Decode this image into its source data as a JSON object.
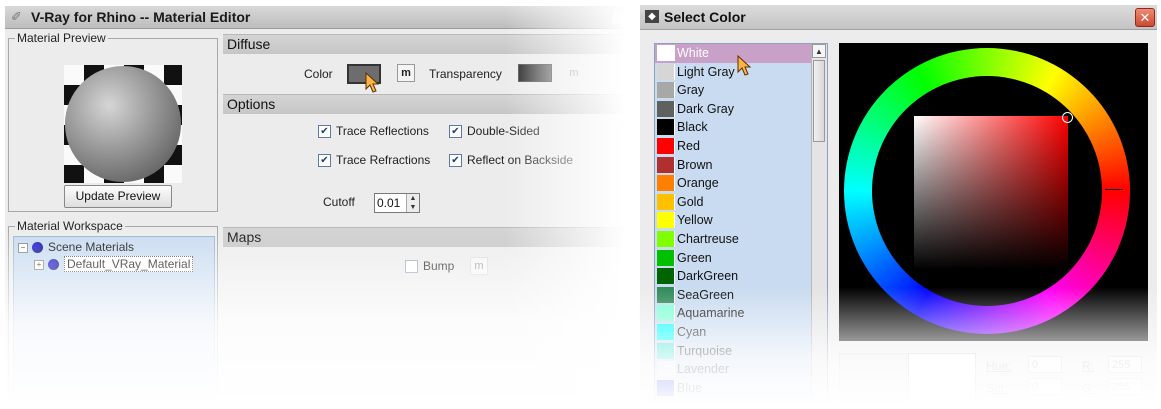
{
  "editor": {
    "title": "V-Ray for Rhino -- Material Editor",
    "preview_legend": "Material Preview",
    "update_button": "Update Preview",
    "workspace_legend": "Material Workspace",
    "tree": {
      "root": "Scene Materials",
      "child": "Default_VRay_Material",
      "root_expander": "−",
      "child_expander": "+"
    },
    "diffuse": {
      "header": "Diffuse",
      "color_label": "Color",
      "m_label": "m",
      "transparency_label": "Transparency"
    },
    "options": {
      "header": "Options",
      "trace_reflections": "Trace Reflections",
      "double_sided": "Double-Sided",
      "trace_refractions": "Trace Refractions",
      "reflect_backside": "Reflect on Backside",
      "cutoff_label": "Cutoff",
      "cutoff_value": "0.01",
      "check_mark": "✔"
    },
    "maps": {
      "header": "Maps",
      "bump_label": "Bump",
      "m_label": "m"
    }
  },
  "select_color": {
    "title": "Select Color",
    "close_glyph": "✕",
    "scroll_up": "▲",
    "colors": [
      {
        "name": "White",
        "hex": "#ffffff"
      },
      {
        "name": "Light Gray",
        "hex": "#d6d6d6"
      },
      {
        "name": "Gray",
        "hex": "#a8a8a8"
      },
      {
        "name": "Dark Gray",
        "hex": "#606060"
      },
      {
        "name": "Black",
        "hex": "#000000"
      },
      {
        "name": "Red",
        "hex": "#ff0000"
      },
      {
        "name": "Brown",
        "hex": "#b03030"
      },
      {
        "name": "Orange",
        "hex": "#ff8000"
      },
      {
        "name": "Gold",
        "hex": "#ffc000"
      },
      {
        "name": "Yellow",
        "hex": "#ffff00"
      },
      {
        "name": "Chartreuse",
        "hex": "#80ff00"
      },
      {
        "name": "Green",
        "hex": "#00c000"
      },
      {
        "name": "DarkGreen",
        "hex": "#006400"
      },
      {
        "name": "SeaGreen",
        "hex": "#2e8b57"
      },
      {
        "name": "Aquamarine",
        "hex": "#7fffd4"
      },
      {
        "name": "Cyan",
        "hex": "#00ffff"
      },
      {
        "name": "Turquoise",
        "hex": "#40e0d0"
      },
      {
        "name": "Lavender",
        "hex": "#e6e6fa"
      },
      {
        "name": "Blue",
        "hex": "#0000ff"
      }
    ],
    "selected_color": "White",
    "hue_label": "Hue:",
    "hue_value": "0",
    "sat_label": "Sat:",
    "sat_value": "0",
    "r_label": "R:",
    "r_value": "255",
    "g_label": "G:",
    "g_value": "255"
  }
}
